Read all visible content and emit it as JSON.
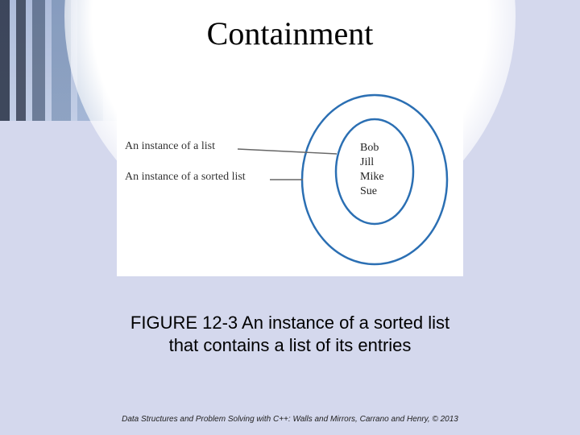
{
  "title": "Containment",
  "figure": {
    "label_list": "An instance of a list",
    "label_sorted_list": "An instance of a sorted list",
    "names": [
      "Bob",
      "Jill",
      "Mike",
      "Sue"
    ]
  },
  "caption_line1": "FIGURE 12-3 An instance of a sorted list",
  "caption_line2": "that contains a list of its entries",
  "footer": "Data Structures and Problem Solving with C++: Walls and Mirrors, Carrano and Henry, ©  2013",
  "colors": {
    "outline": "#2b6fb3"
  }
}
